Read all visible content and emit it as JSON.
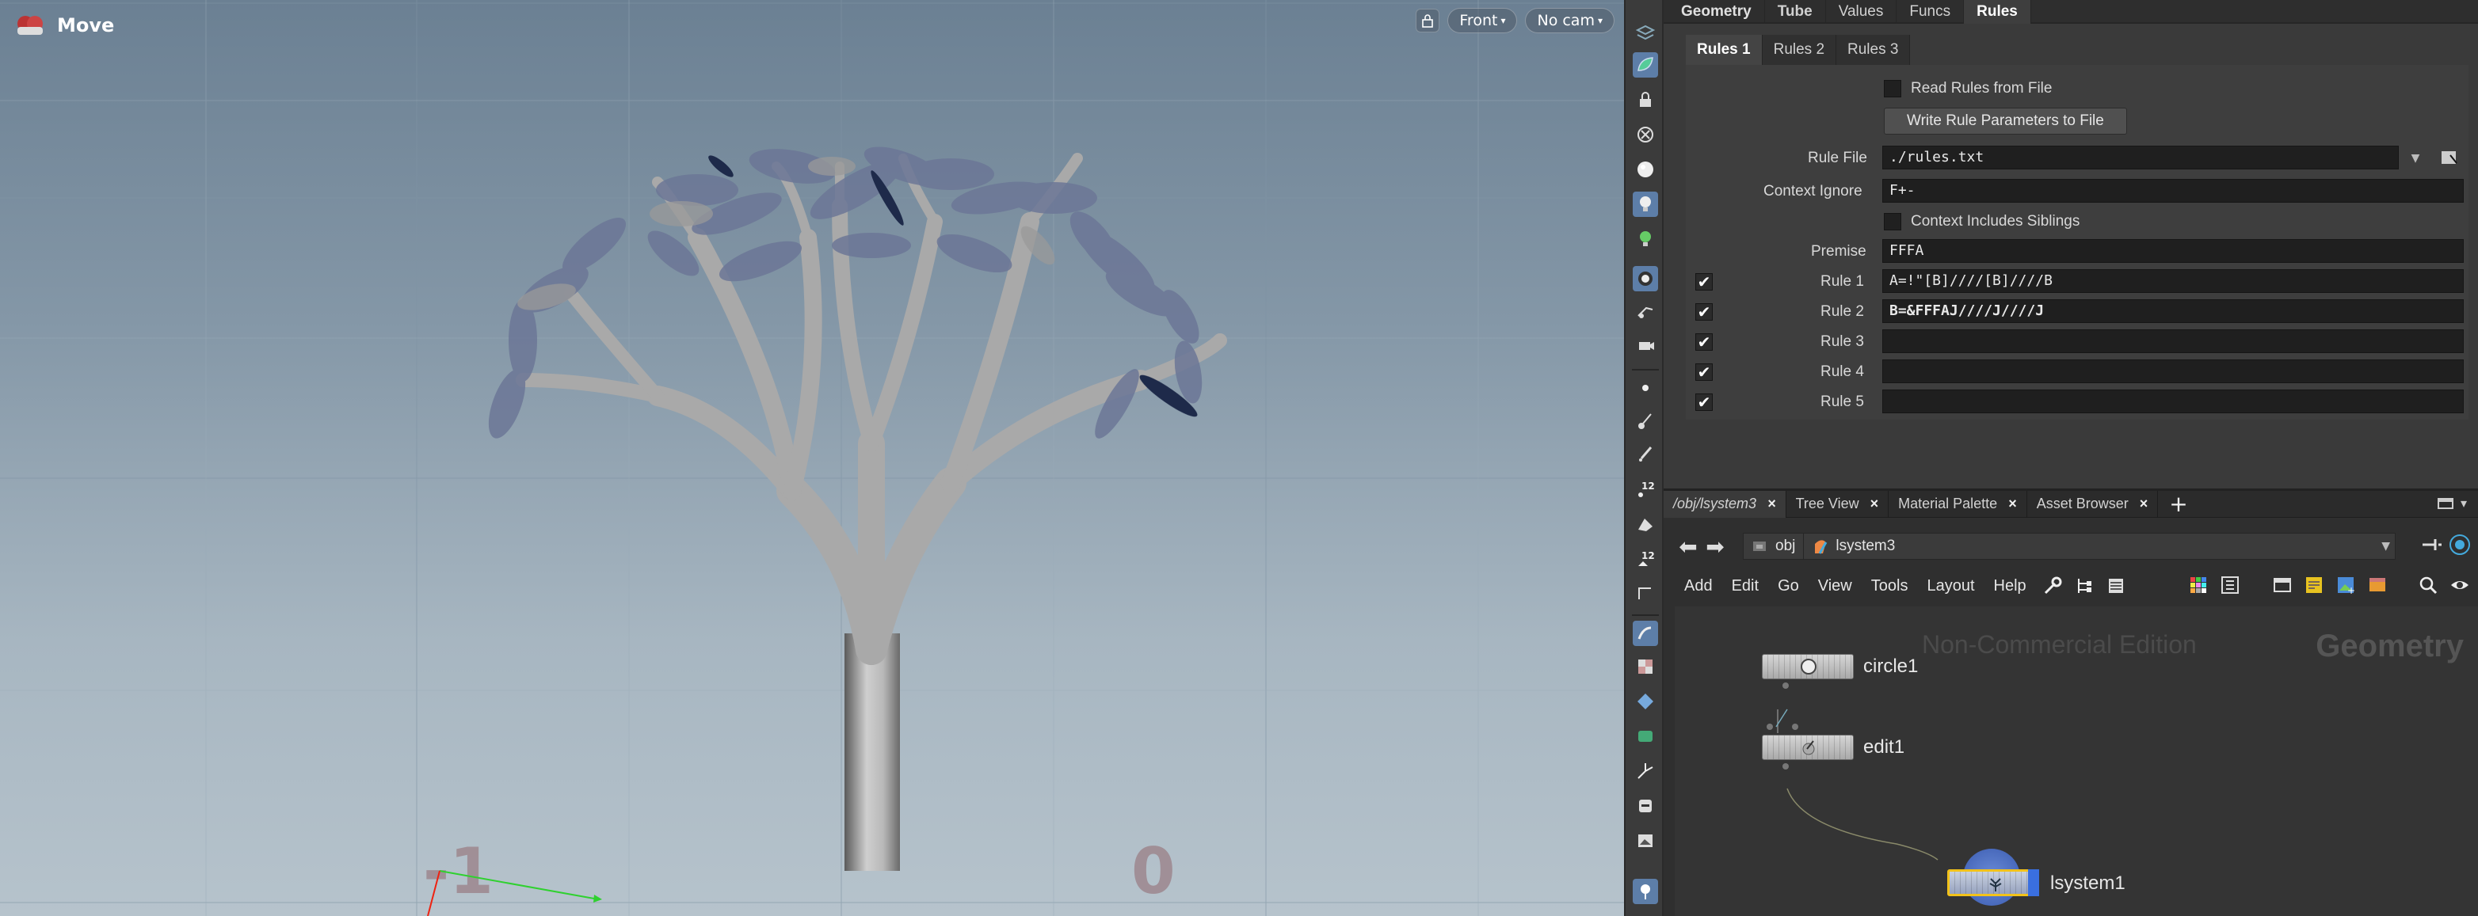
{
  "viewport": {
    "tool_label": "Move",
    "camera_view": "Front",
    "camera_select": "No cam",
    "axis_numbers": [
      "-1",
      "0"
    ]
  },
  "params": {
    "tabs": [
      "Geometry",
      "Tube",
      "Values",
      "Funcs",
      "Rules"
    ],
    "active_tab": "Rules",
    "sub_tabs": [
      "Rules 1",
      "Rules 2",
      "Rules 3"
    ],
    "active_sub_tab": "Rules 1",
    "read_rules_label": "Read Rules from File",
    "write_rules_button": "Write Rule Parameters to File",
    "rule_file_label": "Rule File",
    "rule_file_value": "./rules.txt",
    "context_ignore_label": "Context Ignore",
    "context_ignore_value": "F+-",
    "context_siblings_label": "Context Includes Siblings",
    "premise_label": "Premise",
    "premise_value": "FFFA",
    "rules": [
      {
        "label": "Rule 1",
        "value": "A=!\"[B]////[B]////B",
        "enabled": true
      },
      {
        "label": "Rule 2",
        "value": "B=&FFFAJ////J////J",
        "enabled": true
      },
      {
        "label": "Rule 3",
        "value": "",
        "enabled": true
      },
      {
        "label": "Rule 4",
        "value": "",
        "enabled": true
      },
      {
        "label": "Rule 5",
        "value": "",
        "enabled": true
      }
    ],
    "checkmark": "✔"
  },
  "network": {
    "tabs": [
      {
        "label": "/obj/lsystem3",
        "close": "×"
      },
      {
        "label": "Tree View",
        "close": "×"
      },
      {
        "label": "Material Palette",
        "close": "×"
      },
      {
        "label": "Asset Browser",
        "close": "×"
      }
    ],
    "add_tab": "+",
    "path": [
      "obj",
      "lsystem3"
    ],
    "menu": [
      "Add",
      "Edit",
      "Go",
      "View",
      "Tools",
      "Layout",
      "Help"
    ],
    "watermark": "Non-Commercial Edition",
    "context": "Geometry",
    "nodes": [
      "circle1",
      "edit1",
      "lsystem1"
    ]
  },
  "colors": {
    "accent_blue": "#5d7ea8",
    "node_selected": "#f2c21a",
    "shelf_bg": "#3b3b3b"
  }
}
